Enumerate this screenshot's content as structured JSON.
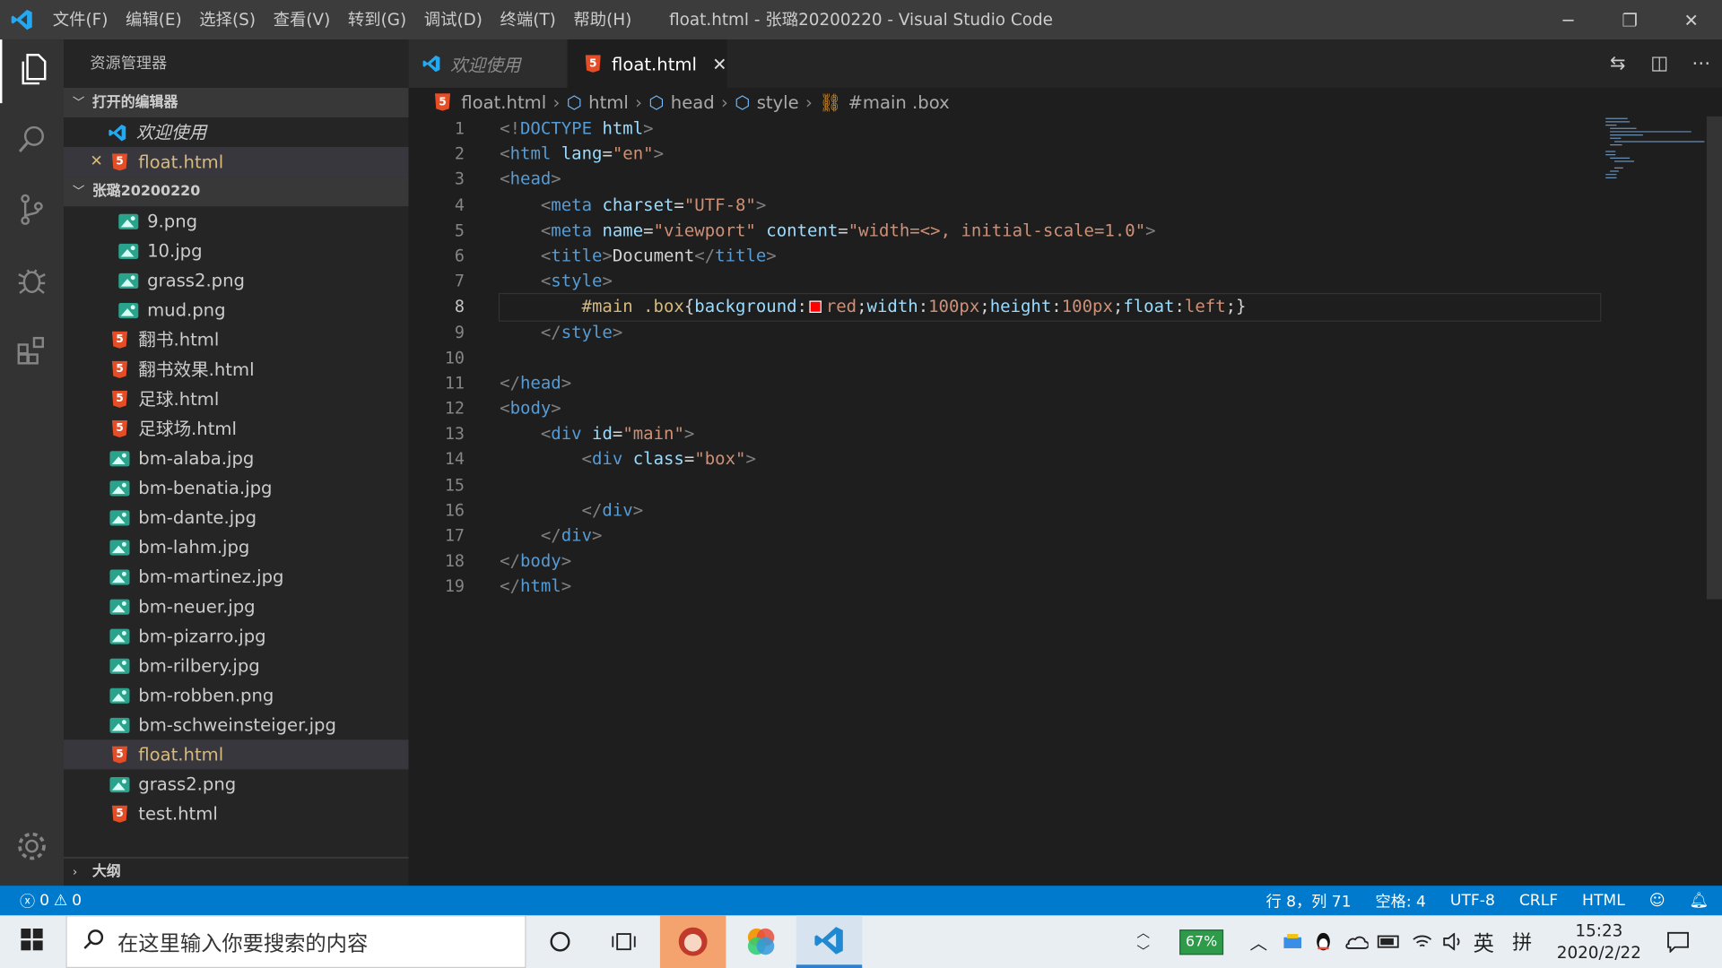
{
  "window": {
    "title": "float.html - 张璐20200220 - Visual Studio Code",
    "menu": [
      "文件(F)",
      "编辑(E)",
      "选择(S)",
      "查看(V)",
      "转到(G)",
      "调试(D)",
      "终端(T)",
      "帮助(H)"
    ],
    "controls": [
      "─",
      "❐",
      "✕"
    ]
  },
  "activity": {
    "items": [
      "files-icon",
      "search-icon",
      "source-control-icon",
      "debug-icon",
      "extensions-icon"
    ],
    "settings": "gear-icon"
  },
  "sidebar": {
    "title": "资源管理器",
    "open_editors_label": "打开的编辑器",
    "open_editors": [
      {
        "name": "欢迎使用",
        "type": "vscode"
      },
      {
        "name": "float.html",
        "type": "html",
        "close": "✕"
      }
    ],
    "folder_label": "张璐20200220",
    "files": [
      {
        "name": "9.png",
        "type": "img",
        "indent": 2
      },
      {
        "name": "10.jpg",
        "type": "img",
        "indent": 2
      },
      {
        "name": "grass2.png",
        "type": "img",
        "indent": 2
      },
      {
        "name": "mud.png",
        "type": "img",
        "indent": 2
      },
      {
        "name": "翻书.html",
        "type": "html",
        "indent": 1
      },
      {
        "name": "翻书效果.html",
        "type": "html",
        "indent": 1
      },
      {
        "name": "足球.html",
        "type": "html",
        "indent": 1
      },
      {
        "name": "足球场.html",
        "type": "html",
        "indent": 1
      },
      {
        "name": "bm-alaba.jpg",
        "type": "img",
        "indent": 1
      },
      {
        "name": "bm-benatia.jpg",
        "type": "img",
        "indent": 1
      },
      {
        "name": "bm-dante.jpg",
        "type": "img",
        "indent": 1
      },
      {
        "name": "bm-lahm.jpg",
        "type": "img",
        "indent": 1
      },
      {
        "name": "bm-martinez.jpg",
        "type": "img",
        "indent": 1
      },
      {
        "name": "bm-neuer.jpg",
        "type": "img",
        "indent": 1
      },
      {
        "name": "bm-pizarro.jpg",
        "type": "img",
        "indent": 1
      },
      {
        "name": "bm-rilbery.jpg",
        "type": "img",
        "indent": 1
      },
      {
        "name": "bm-robben.png",
        "type": "img",
        "indent": 1
      },
      {
        "name": "bm-schweinsteiger.jpg",
        "type": "img",
        "indent": 1
      },
      {
        "name": "float.html",
        "type": "html",
        "indent": 1,
        "selected": true
      },
      {
        "name": "grass2.png",
        "type": "img",
        "indent": 1
      },
      {
        "name": "test.html",
        "type": "html",
        "indent": 1
      }
    ],
    "outline_label": "大纲"
  },
  "tabs": [
    {
      "label": "欢迎使用",
      "active": false
    },
    {
      "label": "float.html",
      "active": true,
      "close": "✕"
    }
  ],
  "breadcrumb": {
    "file": "float.html",
    "parts": [
      "html",
      "head",
      "style"
    ],
    "last": "#main .box"
  },
  "editor": {
    "line_numbers": [
      "1",
      "2",
      "3",
      "4",
      "5",
      "6",
      "7",
      "8",
      "9",
      "10",
      "11",
      "12",
      "13",
      "14",
      "15",
      "16",
      "17",
      "18",
      "19"
    ],
    "lines": [
      [
        [
          "br",
          "<!"
        ],
        [
          "tg",
          "DOCTYPE"
        ],
        [
          "tx",
          " "
        ],
        [
          "at",
          "html"
        ],
        [
          "br",
          ">"
        ]
      ],
      [
        [
          "br",
          "<"
        ],
        [
          "tg",
          "html"
        ],
        [
          "tx",
          " "
        ],
        [
          "at",
          "lang"
        ],
        [
          "tx",
          "="
        ],
        [
          "st",
          "\"en\""
        ],
        [
          "br",
          ">"
        ]
      ],
      [
        [
          "br",
          "<"
        ],
        [
          "tg",
          "head"
        ],
        [
          "br",
          ">"
        ]
      ],
      [
        [
          "tx",
          "    "
        ],
        [
          "br",
          "<"
        ],
        [
          "tg",
          "meta"
        ],
        [
          "tx",
          " "
        ],
        [
          "at",
          "charset"
        ],
        [
          "tx",
          "="
        ],
        [
          "st",
          "\"UTF-8\""
        ],
        [
          "br",
          ">"
        ]
      ],
      [
        [
          "tx",
          "    "
        ],
        [
          "br",
          "<"
        ],
        [
          "tg",
          "meta"
        ],
        [
          "tx",
          " "
        ],
        [
          "at",
          "name"
        ],
        [
          "tx",
          "="
        ],
        [
          "st",
          "\"viewport\""
        ],
        [
          "tx",
          " "
        ],
        [
          "at",
          "content"
        ],
        [
          "tx",
          "="
        ],
        [
          "st",
          "\"width=<>, initial-scale=1.0\""
        ],
        [
          "br",
          ">"
        ]
      ],
      [
        [
          "tx",
          "    "
        ],
        [
          "br",
          "<"
        ],
        [
          "tg",
          "title"
        ],
        [
          "br",
          ">"
        ],
        [
          "tx",
          "Document"
        ],
        [
          "br",
          "</"
        ],
        [
          "tg",
          "title"
        ],
        [
          "br",
          ">"
        ]
      ],
      [
        [
          "tx",
          "    "
        ],
        [
          "br",
          "<"
        ],
        [
          "tg",
          "style"
        ],
        [
          "br",
          ">"
        ]
      ],
      [
        [
          "tx",
          "        "
        ],
        [
          "sel",
          "#main .box"
        ],
        [
          "tx",
          "{"
        ],
        [
          "pr",
          "background"
        ],
        [
          "tx",
          ":"
        ],
        [
          "sw",
          ""
        ],
        [
          "vl",
          "red"
        ],
        [
          "tx",
          ";"
        ],
        [
          "pr",
          "width"
        ],
        [
          "tx",
          ":"
        ],
        [
          "vl",
          "100px"
        ],
        [
          "tx",
          ";"
        ],
        [
          "pr",
          "height"
        ],
        [
          "tx",
          ":"
        ],
        [
          "vl",
          "100px"
        ],
        [
          "tx",
          ";"
        ],
        [
          "pr",
          "float"
        ],
        [
          "tx",
          ":"
        ],
        [
          "vl",
          "left"
        ],
        [
          "tx",
          ";}"
        ]
      ],
      [
        [
          "tx",
          "    "
        ],
        [
          "br",
          "</"
        ],
        [
          "tg",
          "style"
        ],
        [
          "br",
          ">"
        ]
      ],
      [
        [
          "tx",
          ""
        ]
      ],
      [
        [
          "br",
          "</"
        ],
        [
          "tg",
          "head"
        ],
        [
          "br",
          ">"
        ]
      ],
      [
        [
          "br",
          "<"
        ],
        [
          "tg",
          "body"
        ],
        [
          "br",
          ">"
        ]
      ],
      [
        [
          "tx",
          "    "
        ],
        [
          "br",
          "<"
        ],
        [
          "tg",
          "div"
        ],
        [
          "tx",
          " "
        ],
        [
          "at",
          "id"
        ],
        [
          "tx",
          "="
        ],
        [
          "st",
          "\"main\""
        ],
        [
          "br",
          ">"
        ]
      ],
      [
        [
          "tx",
          "        "
        ],
        [
          "br",
          "<"
        ],
        [
          "tg",
          "div"
        ],
        [
          "tx",
          " "
        ],
        [
          "at",
          "class"
        ],
        [
          "tx",
          "="
        ],
        [
          "st",
          "\"box\""
        ],
        [
          "br",
          ">"
        ]
      ],
      [
        [
          "tx",
          ""
        ]
      ],
      [
        [
          "tx",
          "        "
        ],
        [
          "br",
          "</"
        ],
        [
          "tg",
          "div"
        ],
        [
          "br",
          ">"
        ]
      ],
      [
        [
          "tx",
          "    "
        ],
        [
          "br",
          "</"
        ],
        [
          "tg",
          "div"
        ],
        [
          "br",
          ">"
        ]
      ],
      [
        [
          "br",
          "</"
        ],
        [
          "tg",
          "body"
        ],
        [
          "br",
          ">"
        ]
      ],
      [
        [
          "br",
          "</"
        ],
        [
          "tg",
          "html"
        ],
        [
          "br",
          ">"
        ]
      ]
    ],
    "current_line": 8
  },
  "status": {
    "errors": "0",
    "warnings": "0",
    "position": "行 8，列 71",
    "spaces": "空格: 4",
    "encoding": "UTF-8",
    "eol": "CRLF",
    "language": "HTML"
  },
  "taskbar": {
    "search_placeholder": "在这里输入你要搜索的内容",
    "battery": "67%",
    "ime_lang": "英",
    "ime_mode": "拼",
    "time": "15:23",
    "date": "2020/2/22"
  },
  "colors": {
    "accent": "#007acc",
    "swatch": "#ff0000"
  }
}
